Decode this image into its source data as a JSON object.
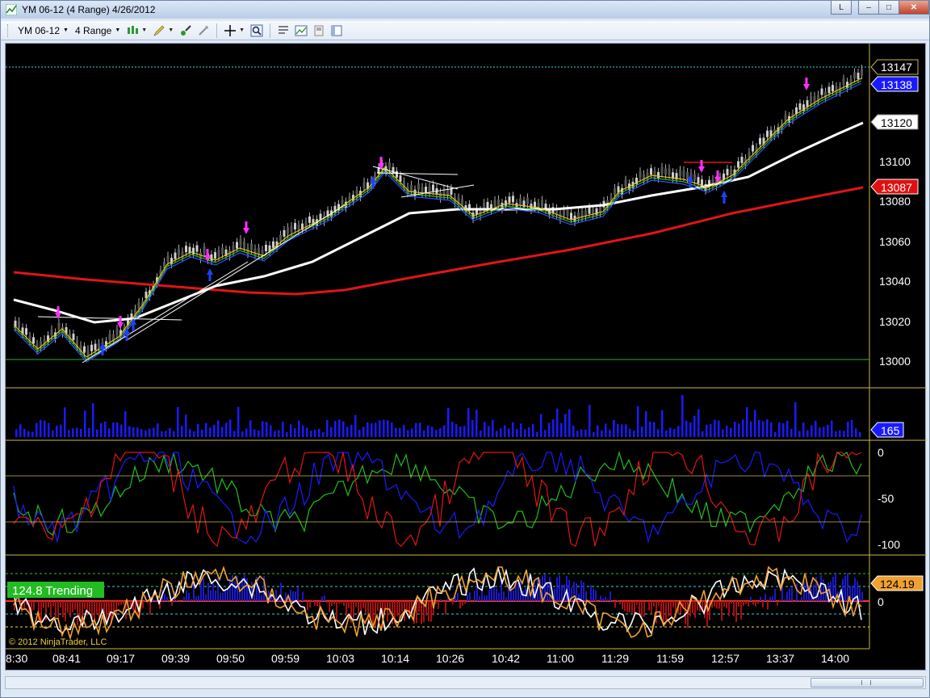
{
  "window": {
    "title": "YM 06-12 (4 Range)  4/26/2012",
    "buttons": {
      "l": "L",
      "minimize": "–",
      "maximize": "□",
      "close": "✕"
    }
  },
  "toolbar": {
    "instrument": "YM 06-12",
    "period": "4 Range"
  },
  "chart": {
    "copyright": "© 2012 NinjaTrader, LLC",
    "trend_label": "124.8 Trending",
    "price_ticks": [
      "13100",
      "13080",
      "13060",
      "13040",
      "13020",
      "13000"
    ],
    "price_markers": [
      {
        "label": "13147",
        "color": "#ffffff",
        "bg": "#000000"
      },
      {
        "label": "13138",
        "color": "#ffffff",
        "bg": "#1a1aff"
      },
      {
        "label": "13120",
        "color": "#000000",
        "bg": "#ffffff"
      },
      {
        "label": "13087",
        "color": "#ffffff",
        "bg": "#e01010"
      }
    ],
    "volume_marker": "165",
    "osc_ticks": [
      "0",
      "-50",
      "-100"
    ],
    "bottom_ticks": [
      "0"
    ],
    "bottom_marker": "124.19",
    "time_labels": [
      "8:30",
      "08:41",
      "09:17",
      "09:39",
      "09:50",
      "09:59",
      "10:03",
      "10:14",
      "10:26",
      "10:42",
      "11:00",
      "11:29",
      "11:59",
      "12:57",
      "13:37",
      "14:00"
    ],
    "colors": {
      "background": "#000000",
      "price_line_teal": "#20b0b0",
      "ema_white": "#ffffff",
      "ema_red": "#e01515",
      "volume": "#1a1aff",
      "osc_red": "#e01515",
      "osc_blue": "#1a1aff",
      "osc_green": "#20c020",
      "arrow_magenta": "#ff30ff",
      "trend_label_bg": "#22bb22"
    }
  }
}
